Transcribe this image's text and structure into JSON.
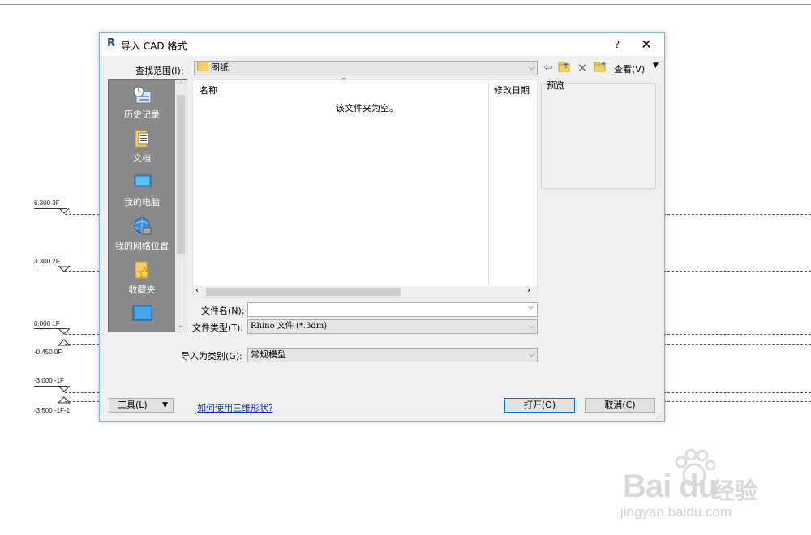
{
  "dialog": {
    "app_icon_letter": "R",
    "title": "导入 CAD 格式",
    "help_glyph": "?",
    "close_glyph": "✕"
  },
  "lookin": {
    "label": "查找范围(I):",
    "value": "图纸",
    "view_label": "查看(V)"
  },
  "places": [
    {
      "label": "历史记录",
      "icon": "history-icon"
    },
    {
      "label": "文档",
      "icon": "documents-icon"
    },
    {
      "label": "我的电脑",
      "icon": "computer-icon"
    },
    {
      "label": "我的网络位置",
      "icon": "network-icon"
    },
    {
      "label": "收藏夹",
      "icon": "favorites-icon"
    }
  ],
  "filelist": {
    "col_name": "名称",
    "col_modified": "修改日期",
    "empty_message": "该文件夹为空。"
  },
  "preview": {
    "label": "预览"
  },
  "form": {
    "filename_label": "文件名(N):",
    "filename_value": "",
    "filetype_label": "文件类型(T):",
    "filetype_value": "Rhino 文件  (*.3dm)",
    "category_label": "导入为类别(G):",
    "category_value": "常规模型"
  },
  "footer": {
    "tools_label": "工具(L)",
    "help_link": "如何使用三维形状?",
    "open_label": "打开(O)",
    "cancel_label": "取消(C)"
  },
  "levels": [
    {
      "label": "6.300 3F"
    },
    {
      "label": "3.300 2F"
    },
    {
      "label": "0.000 1F"
    },
    {
      "label": "-0.450 0F"
    },
    {
      "label": "-3.000 -1F"
    },
    {
      "label": "-3.500 -1F-1"
    }
  ],
  "watermark": {
    "logo": "Bai  du",
    "brand": "经验",
    "url": "jingyan.baidu.com"
  },
  "colors": {
    "accent": "#0078d7",
    "dialog_border": "#7eb4d6",
    "link": "#0033cc"
  }
}
